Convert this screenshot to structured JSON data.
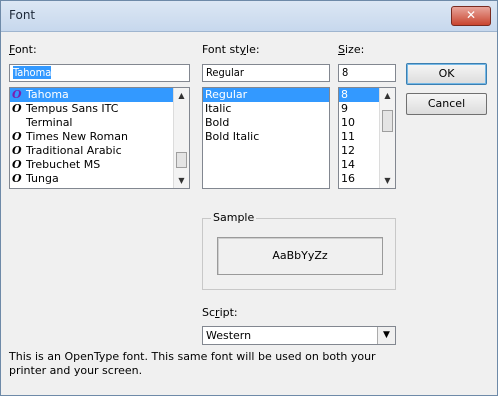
{
  "window": {
    "title": "Font",
    "close_glyph": "✕"
  },
  "font": {
    "label_prefix": "F",
    "label_rest": "ont:",
    "value": "Tahoma",
    "items": [
      {
        "name": "Tahoma",
        "icon": "O",
        "selected": true
      },
      {
        "name": "Tempus Sans ITC",
        "icon": "O"
      },
      {
        "name": "Terminal",
        "icon": ""
      },
      {
        "name": "Times New Roman",
        "icon": "O"
      },
      {
        "name": "Traditional Arabic",
        "icon": "O"
      },
      {
        "name": "Trebuchet MS",
        "icon": "O"
      },
      {
        "name": "Tunga",
        "icon": "O"
      }
    ]
  },
  "style": {
    "label_prefix": "Font st",
    "label_u": "y",
    "label_rest": "le:",
    "value": "Regular",
    "items": [
      "Regular",
      "Italic",
      "Bold",
      "Bold Italic"
    ]
  },
  "size": {
    "label_prefix": "S",
    "label_rest": "ize:",
    "value": "8",
    "items": [
      "8",
      "9",
      "10",
      "11",
      "12",
      "14",
      "16"
    ]
  },
  "buttons": {
    "ok": "OK",
    "cancel": "Cancel"
  },
  "sample": {
    "title": "Sample",
    "text": "AaBbYyZz"
  },
  "script": {
    "label_prefix": "Sc",
    "label_u": "r",
    "label_rest": "ipt:",
    "value": "Western"
  },
  "info_text": "This is an OpenType font. This same font will be used on both your printer and your screen."
}
